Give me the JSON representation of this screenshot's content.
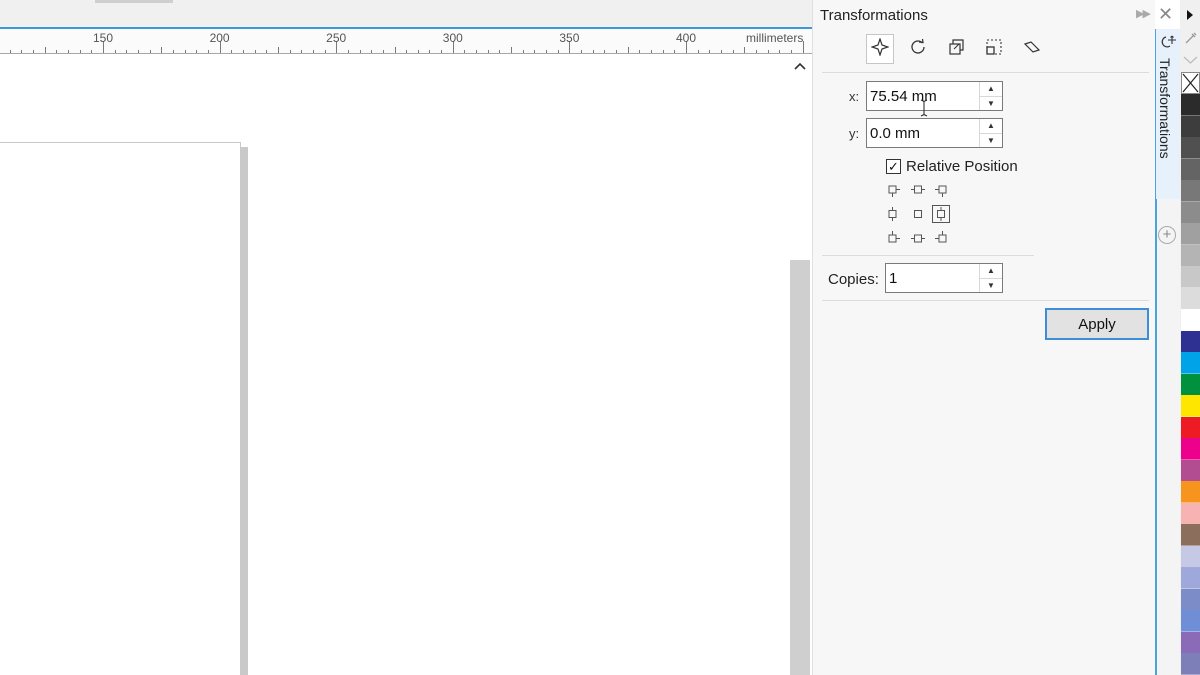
{
  "ruler": {
    "labels": [
      "150",
      "200",
      "250",
      "300",
      "350",
      "400"
    ],
    "unit": "millimeters"
  },
  "docker": {
    "title": "Transformations",
    "tab_label": "Transformations",
    "tools": [
      "position-tool",
      "rotate-tool",
      "scale-mirror-tool",
      "size-tool",
      "skew-tool"
    ],
    "active_tool": "position-tool"
  },
  "position": {
    "x_label": "x:",
    "x_value": "75.54 mm",
    "y_label": "y:",
    "y_value": "0.0 mm",
    "relative_label": "Relative Position",
    "relative_checked": true,
    "anchor_selected": "middle-right"
  },
  "copies": {
    "label": "Copies:",
    "value": "1"
  },
  "apply_label": "Apply",
  "palette": {
    "colors": [
      "#2b2b2b",
      "#3d3d3d",
      "#505050",
      "#646464",
      "#787878",
      "#8c8c8c",
      "#a0a0a0",
      "#b4b4b4",
      "#c8c8c8",
      "#dcdcdc",
      "#ffffff",
      "#2e3192",
      "#00a2e8",
      "#00913f",
      "#ffe600",
      "#ed1c24",
      "#ec008c",
      "#b14d90",
      "#f7941d",
      "#f7b2b2",
      "#8c6e5d",
      "#c5c9e6",
      "#9fa8da",
      "#7c8cc9",
      "#6f8ed6",
      "#8b6bb7",
      "#7d7fb9"
    ]
  }
}
